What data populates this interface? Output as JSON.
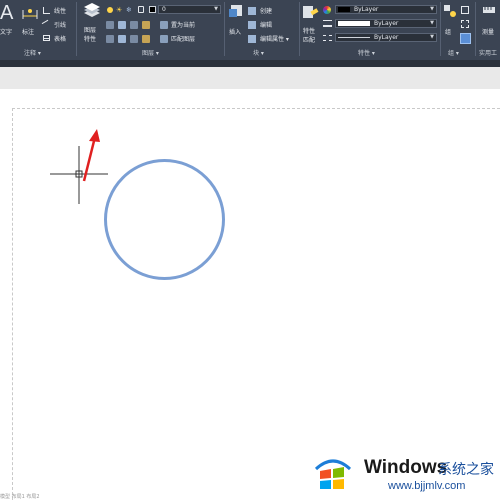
{
  "ribbon": {
    "annotation": {
      "text_label": "文字",
      "dim_label": "标注",
      "linear": "线性",
      "leader": "引线",
      "table": "表格",
      "panel": "注释 ▾"
    },
    "layers": {
      "props_label_1": "图层",
      "props_label_2": "特性",
      "current_layer": "0",
      "make_current": "置为当前",
      "match_layer": "匹配图层",
      "panel": "图层 ▾"
    },
    "block": {
      "insert": "插入",
      "create": "创建",
      "edit": "编辑",
      "edit_attr": "编辑属性 ▾",
      "panel": "块 ▾"
    },
    "properties": {
      "match_1": "特性",
      "match_2": "匹配",
      "color": "ByLayer",
      "lineweight": "ByLayer",
      "linetype": "ByLayer",
      "panel": "特性 ▾"
    },
    "groups": {
      "group": "组",
      "panel": "组 ▾"
    },
    "utilities": {
      "measure": "测量",
      "panel": "实用工"
    }
  },
  "watermark": {
    "brand": "Windows",
    "suffix": "系统之家",
    "url": "www.bjjmlv.com"
  },
  "status": {
    "text": "模型   布局1   布局2"
  },
  "colors": {
    "ribbon_bg": "#3b4453",
    "circle": "#7b9fd4",
    "arrow": "#e02020",
    "canvas": "#ffffff"
  }
}
